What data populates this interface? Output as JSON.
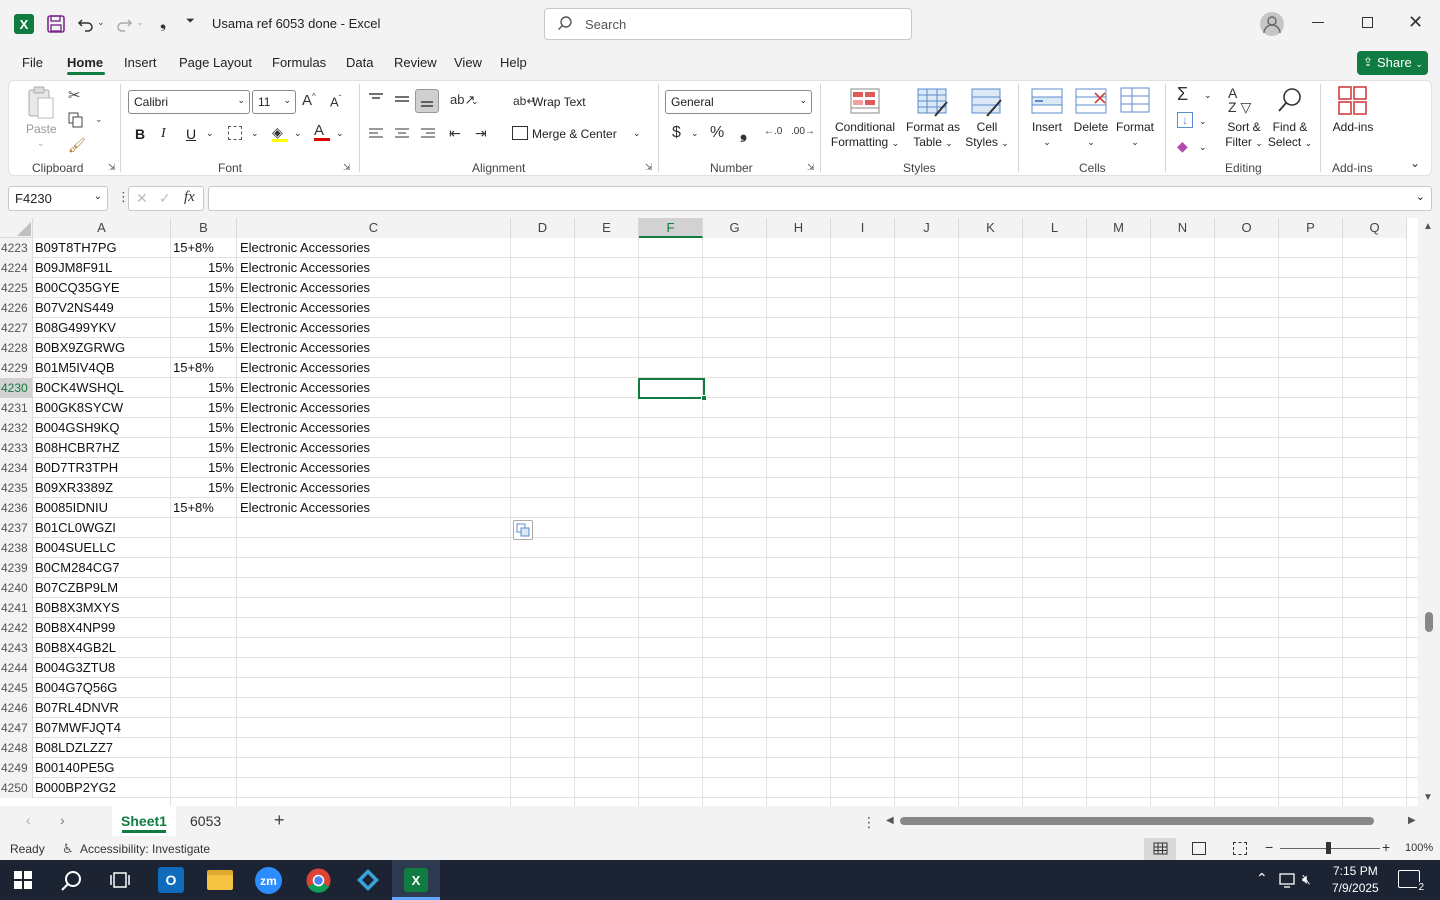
{
  "app": {
    "title": "Usama ref 6053 done  -  Excel",
    "search_placeholder": "Search",
    "share_label": "Share"
  },
  "menu": [
    "File",
    "Home",
    "Insert",
    "Page Layout",
    "Formulas",
    "Data",
    "Review",
    "View",
    "Help"
  ],
  "ribbon": {
    "clipboard": {
      "paste": "Paste",
      "label": "Clipboard"
    },
    "font": {
      "name": "Calibri",
      "size": "11",
      "label": "Font"
    },
    "alignment": {
      "wrap": "Wrap Text",
      "merge": "Merge & Center",
      "label": "Alignment"
    },
    "number": {
      "format": "General",
      "label": "Number"
    },
    "styles": {
      "conditional": "Conditional",
      "conditional2": "Formatting",
      "format_table": "Format as",
      "format_table2": "Table",
      "cell_styles": "Cell",
      "cell_styles2": "Styles",
      "label": "Styles"
    },
    "cells": {
      "insert": "Insert",
      "delete": "Delete",
      "format": "Format",
      "label": "Cells"
    },
    "editing": {
      "sort": "Sort &",
      "sort2": "Filter",
      "find": "Find &",
      "find2": "Select",
      "label": "Editing"
    },
    "addins": {
      "addins": "Add-ins",
      "label": "Add-ins"
    }
  },
  "formula_bar": {
    "name_box": "F4230",
    "fx": "fx",
    "value": ""
  },
  "columns": [
    "A",
    "B",
    "C",
    "D",
    "E",
    "F",
    "G",
    "H",
    "I",
    "J",
    "K",
    "L",
    "M",
    "N",
    "O",
    "P",
    "Q"
  ],
  "selected_column": "F",
  "selected_row": "4230",
  "rows": [
    {
      "n": "4223",
      "a": "B09T8TH7PG",
      "b": "15+8%",
      "b_align": "left",
      "c": "Electronic Accessories"
    },
    {
      "n": "4224",
      "a": "B09JM8F91L",
      "b": "15%",
      "b_align": "right",
      "c": "Electronic Accessories"
    },
    {
      "n": "4225",
      "a": "B00CQ35GYE",
      "b": "15%",
      "b_align": "right",
      "c": "Electronic Accessories"
    },
    {
      "n": "4226",
      "a": "B07V2NS449",
      "b": "15%",
      "b_align": "right",
      "c": "Electronic Accessories"
    },
    {
      "n": "4227",
      "a": "B08G499YKV",
      "b": "15%",
      "b_align": "right",
      "c": "Electronic Accessories"
    },
    {
      "n": "4228",
      "a": "B0BX9ZGRWG",
      "b": "15%",
      "b_align": "right",
      "c": "Electronic Accessories"
    },
    {
      "n": "4229",
      "a": "B01M5IV4QB",
      "b": "15+8%",
      "b_align": "left",
      "c": "Electronic Accessories"
    },
    {
      "n": "4230",
      "a": "B0CK4WSHQL",
      "b": "15%",
      "b_align": "right",
      "c": "Electronic Accessories"
    },
    {
      "n": "4231",
      "a": "B00GK8SYCW",
      "b": "15%",
      "b_align": "right",
      "c": "Electronic Accessories"
    },
    {
      "n": "4232",
      "a": "B004GSH9KQ",
      "b": "15%",
      "b_align": "right",
      "c": "Electronic Accessories"
    },
    {
      "n": "4233",
      "a": "B08HCBR7HZ",
      "b": "15%",
      "b_align": "right",
      "c": "Electronic Accessories"
    },
    {
      "n": "4234",
      "a": "B0D7TR3TPH",
      "b": "15%",
      "b_align": "right",
      "c": "Electronic Accessories"
    },
    {
      "n": "4235",
      "a": "B09XR3389Z",
      "b": "15%",
      "b_align": "right",
      "c": "Electronic Accessories"
    },
    {
      "n": "4236",
      "a": "B0085IDNIU",
      "b": "15+8%",
      "b_align": "left",
      "c": "Electronic Accessories"
    },
    {
      "n": "4237",
      "a": "B01CL0WGZI",
      "b": "",
      "b_align": "left",
      "c": ""
    },
    {
      "n": "4238",
      "a": "B004SUELLC",
      "b": "",
      "b_align": "left",
      "c": ""
    },
    {
      "n": "4239",
      "a": "B0CM284CG7",
      "b": "",
      "b_align": "left",
      "c": ""
    },
    {
      "n": "4240",
      "a": "B07CZBP9LM",
      "b": "",
      "b_align": "left",
      "c": ""
    },
    {
      "n": "4241",
      "a": "B0B8X3MXYS",
      "b": "",
      "b_align": "left",
      "c": ""
    },
    {
      "n": "4242",
      "a": "B0B8X4NP99",
      "b": "",
      "b_align": "left",
      "c": ""
    },
    {
      "n": "4243",
      "a": "B0B8X4GB2L",
      "b": "",
      "b_align": "left",
      "c": ""
    },
    {
      "n": "4244",
      "a": "B004G3ZTU8",
      "b": "",
      "b_align": "left",
      "c": ""
    },
    {
      "n": "4245",
      "a": "B004G7Q56G",
      "b": "",
      "b_align": "left",
      "c": ""
    },
    {
      "n": "4246",
      "a": "B07RL4DNVR",
      "b": "",
      "b_align": "left",
      "c": ""
    },
    {
      "n": "4247",
      "a": "B07MWFJQT4",
      "b": "",
      "b_align": "left",
      "c": ""
    },
    {
      "n": "4248",
      "a": "B08LDZLZZ7",
      "b": "",
      "b_align": "left",
      "c": ""
    },
    {
      "n": "4249",
      "a": "B00140PE5G",
      "b": "",
      "b_align": "left",
      "c": ""
    },
    {
      "n": "4250",
      "a": "B000BP2YG2",
      "b": "",
      "b_align": "left",
      "c": ""
    }
  ],
  "sheets": [
    "Sheet1",
    "6053"
  ],
  "active_sheet": "Sheet1",
  "status": {
    "ready": "Ready",
    "accessibility": "Accessibility: Investigate",
    "zoom": "100%"
  },
  "taskbar": {
    "time": "7:15 PM",
    "date": "7/9/2025",
    "notif_count": "2"
  },
  "colors": {
    "excel_green": "#107c41",
    "share_green": "#107c41",
    "selected_header": "#d2d2d2"
  }
}
